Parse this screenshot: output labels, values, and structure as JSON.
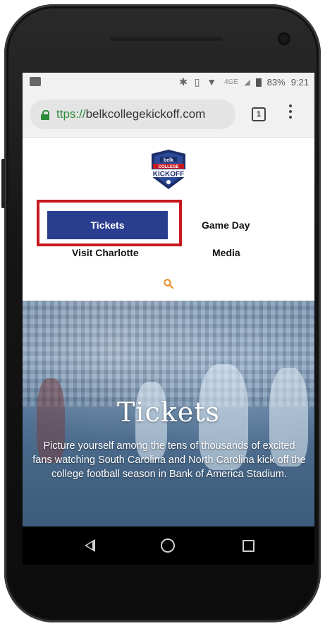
{
  "status_bar": {
    "battery": "83%",
    "time": "9:21",
    "network": "4GE"
  },
  "browser": {
    "url_scheme": "ttps://",
    "url_host": "belkcollegekickoff.com",
    "tab_count": "1"
  },
  "logo": {
    "text_top": "belk",
    "text_mid": "COLLEGE",
    "text_main": "KICKOFF"
  },
  "nav": {
    "tickets": "Tickets",
    "game_day": "Game Day",
    "visit_charlotte": "Visit Charlotte",
    "media": "Media"
  },
  "hero": {
    "title": "Tickets",
    "text": "Picture yourself among the tens of thousands of excited fans watching South Carolina and North Carolina kick off the college football season in Bank of America Stadium."
  },
  "colors": {
    "accent_blue": "#2a3e8f",
    "highlight_red": "#c8191f",
    "search_orange": "#e58a1f",
    "lock_green": "#2e8b3a"
  },
  "icons": {
    "search": "search-icon",
    "lock": "lock-icon",
    "back": "back-icon",
    "home": "home-icon",
    "recents": "recents-icon"
  }
}
